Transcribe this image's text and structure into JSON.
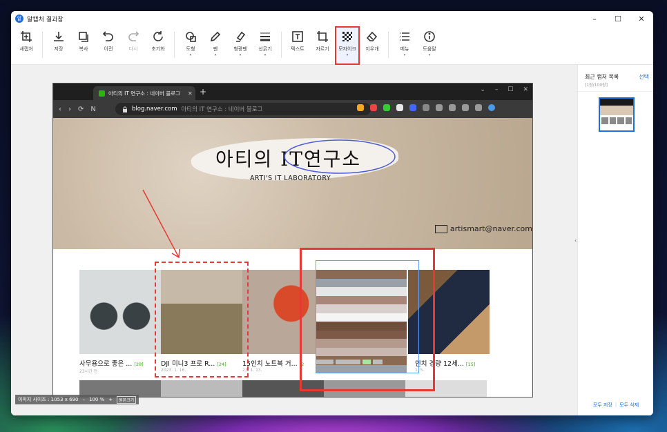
{
  "app": {
    "title": "알캡처 결과창",
    "icon": "알"
  },
  "window_controls": {
    "minimize": "–",
    "maximize": "☐",
    "close": "✕"
  },
  "toolbar": {
    "new_capture": "새캡처",
    "save": "저장",
    "copy": "복사",
    "undo": "이전",
    "redo": "다시",
    "reset": "초기화",
    "shape": "도형",
    "pen": "펜",
    "highlighter": "형광펜",
    "line_thickness": "선굵기",
    "text": "텍스트",
    "crop": "자르기",
    "mosaic": "모자이크",
    "eraser": "지우개",
    "menu": "메뉴",
    "help": "도움말",
    "dropdown": "▾"
  },
  "sidebar": {
    "title": "최근 캡처 목록",
    "select": "선택",
    "count": "[1장/100장]",
    "save_all": "모두 저장",
    "divider": "|",
    "delete_all": "모두 삭제",
    "collapse": "‹"
  },
  "browser": {
    "tab_title": "아티의 IT 연구소 : 네이버 블로그",
    "tab_close": "✕",
    "new_tab": "+",
    "host": "blog.naver.com",
    "page_title": "아티의 IT 연구소 : 네이버 블로그",
    "win_controls": [
      "⌄",
      "–",
      "☐",
      "✕"
    ],
    "nav": [
      "‹",
      "›",
      "⟳",
      "N"
    ]
  },
  "blog": {
    "logo": "아티의 IT연구소",
    "subtitle": "ARTI'S IT LABORATORY",
    "email": "artismart@naver.com",
    "posts": [
      {
        "title": "사무용으로 좋은 ...",
        "count": "[28]",
        "date": "23시간 전"
      },
      {
        "title": "DJI 미니3 프로 R...",
        "count": "[24]",
        "date": "2023. 1. 16."
      },
      {
        "title": "15인치 노트북 거...",
        "count": "[2",
        "date": "23. 1. 13."
      },
      {
        "title": "인치 경량 12세...",
        "count": "[15]",
        "date": "1. 5."
      }
    ]
  },
  "status": {
    "size_label": "이미지 사이즈 : 1053 x 690",
    "zoom_out": "–",
    "zoom": "100 %",
    "zoom_in": "+",
    "original": "원본크기"
  },
  "colors": {
    "accent": "#1e6fd8",
    "annotation": "#e53935",
    "naver": "#2db400"
  }
}
